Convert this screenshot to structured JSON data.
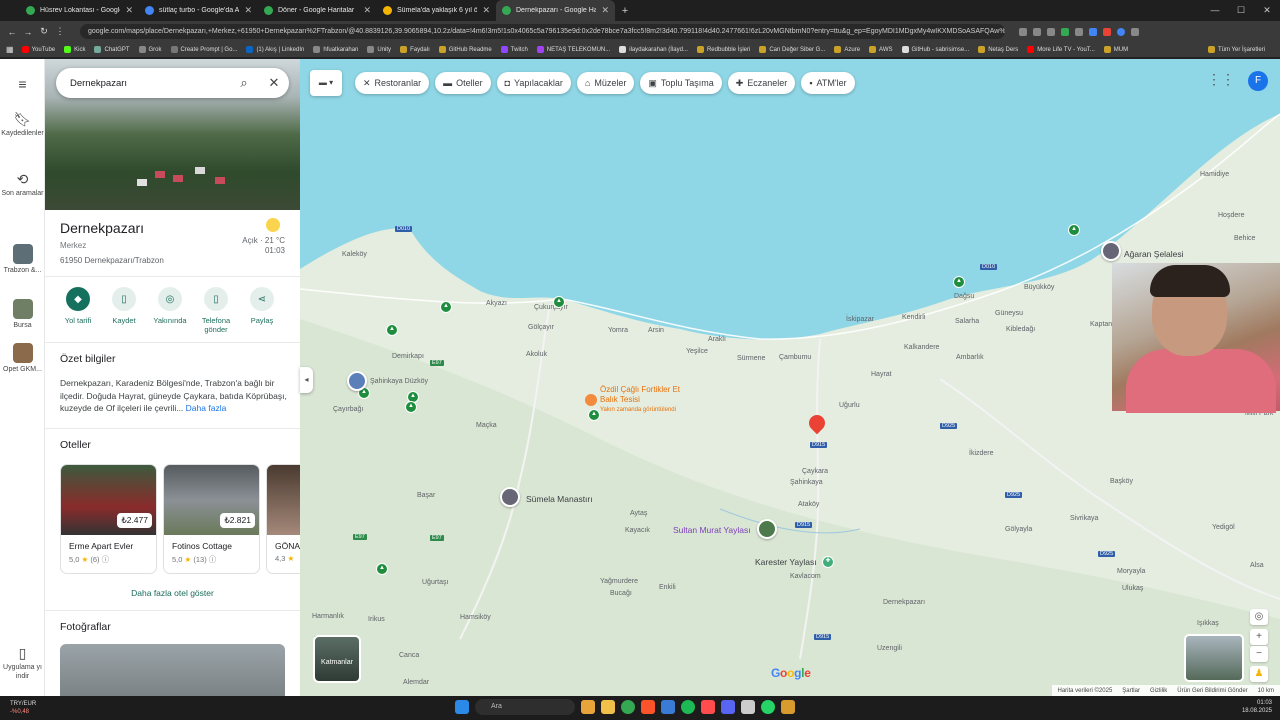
{
  "browser": {
    "tabs": [
      {
        "title": "Hüsrev Lokantası - Google Harita",
        "color": "#34a853"
      },
      {
        "title": "sütlaç turbo - Google'da Ara",
        "color": "#4285f4"
      },
      {
        "title": "Döner - Google Haritalar",
        "color": "#34a853"
      },
      {
        "title": "Sümela'da yaklaşık 6 yıl önce b",
        "color": "#f4b400"
      },
      {
        "title": "Dernekpazarı - Google Haritalar",
        "color": "#34a853"
      }
    ],
    "url": "google.com/maps/place/Dernekpazarı,+Merkez,+61950+Dernekpazarı%2FTrabzon/@40.8839126,39.9065894,10.2z/data=!4m6!3m5!1s0x4065c5a796135e9d:0x2de78bce7a3fcc5!8m2!3d40.799118!4d40.2477661!6zL20vMGNtbmN0?entry=ttu&g_ep=EgoyMDI1MDgxMy4wIKXMDSoASAFQAw%3D%3D",
    "bookmarks": [
      "YouTube",
      "Kick",
      "ChatGPT",
      "Grok",
      "Create Prompt | Go...",
      "(1) Akış | LinkedIn",
      "hfuatkarahan",
      "Unity",
      "Faydalı",
      "GitHub Readme",
      "Twitch",
      "NETAŞ TELEKOMUN...",
      "ilaydakarahan (İlayd...",
      "Redbubble İşleri",
      "Can Değer Siber G...",
      "Azure",
      "AWS",
      "GitHub - sabrisimse...",
      "Netaş Ders",
      "More Life TV - YouT...",
      "MUM"
    ],
    "all_bookmarks": "Tüm Yer İşaretleri"
  },
  "rail": {
    "saved": "Kaydedilenler",
    "recent": "Son aramalar",
    "recents": [
      "Trabzon &...",
      "Bursa",
      "Opet GKM..."
    ],
    "get_app": "Uygulama yı indir"
  },
  "search": {
    "value": "Dernekpazarı"
  },
  "place": {
    "title": "Dernekpazarı",
    "subtitle": "Merkez",
    "address": "61950 Dernekpazarı/Trabzon",
    "weather": "Açık · 21 °C",
    "time": "01:03"
  },
  "actions": [
    "Yol tarifi",
    "Kaydet",
    "Yakınında",
    "Telefona gönder",
    "Paylaş"
  ],
  "summary": {
    "heading": "Özet bilgiler",
    "text": "Dernekpazarı, Karadeniz Bölgesi'nde, Trabzon'a bağlı bir ilçedir. Doğuda Hayrat, güneyde Çaykara, batıda Köprübaşı, kuzeyde de Of ilçeleri ile çevrili...",
    "more": "Daha fazla"
  },
  "hotels": {
    "heading": "Oteller",
    "items": [
      {
        "name": "Erme Apart Evler",
        "price": "₺2.477",
        "rating": "5,0",
        "count": "(6)"
      },
      {
        "name": "Fotinos Cottage",
        "price": "₺2.821",
        "rating": "5,0",
        "count": "(13)"
      },
      {
        "name": "GÖNA",
        "price": "",
        "rating": "4,3",
        "count": ""
      }
    ],
    "more": "Daha fazla otel göster"
  },
  "photos_heading": "Fotoğraflar",
  "chips": [
    "Restoranlar",
    "Oteller",
    "Yapılacaklar",
    "Müzeler",
    "Toplu Taşıma",
    "Eczaneler",
    "ATM'ler"
  ],
  "avatar_letter": "F",
  "map_labels": [
    "Hamidiye",
    "Hoşdere",
    "Behice",
    "Ağaran Şelalesi",
    "Büyükköy",
    "Dağsu",
    "Güneysu",
    "Kaptanpaşa",
    "Salarha",
    "Kibledağı",
    "Kendirli",
    "İskipazar",
    "Kalkandere",
    "Ambarlık",
    "Hayrat",
    "Uğurlu",
    "Çaykara",
    "Şahinkaya",
    "Ataköy",
    "Çambumu",
    "Sürmene",
    "Yeşilce",
    "Arsin",
    "Yomra",
    "Araklı",
    "Akyazı",
    "Çukurçayır",
    "Gölçayır",
    "Akoluk",
    "Demirkapı",
    "Kaleköy",
    "Şahinkaya Düzköy",
    "Çayırbağı",
    "Maçka",
    "Sümela Manastırı",
    "Başar",
    "Aytaş",
    "Kayacık",
    "Sultan Murat Yaylası",
    "Karester Yaylası",
    "Yağmurdere",
    "Bucağı",
    "Enkili",
    "Kavlacom",
    "Dernekpazarı",
    "Uzengili",
    "Hamsiköy",
    "Gölyayla",
    "İkizdere",
    "Başköy",
    "Sivrikaya",
    "Yedigöl",
    "Moryayla",
    "Ulukaş",
    "Işıkkaş",
    "Irikus",
    "Alemdar",
    "Canca",
    "Uğurtaşı",
    "Harmanlık",
    "Arpa",
    "Milli Park",
    "Alsa"
  ],
  "roads": [
    "D010",
    "D010",
    "D915",
    "D915",
    "D925",
    "D925",
    "D925",
    "E97",
    "E97",
    "E97",
    "D915"
  ],
  "poi": {
    "restaurant": "Özdil Çağlı Fortikler Et Balık Tesisi",
    "restaurant_note": "Yakın zamanda görüntülendi"
  },
  "layers_label": "Katmanlar",
  "footer": [
    "Harita verileri ©2025",
    "Şartlar",
    "Gizlilik",
    "Ürün Geri Bildirimi Gönder",
    "10 km"
  ],
  "taskbar": {
    "search": "Ara",
    "fx": "TRY/EUR",
    "fx_change": "-%0,48",
    "time": "01:03",
    "date": "18.08.2025"
  }
}
